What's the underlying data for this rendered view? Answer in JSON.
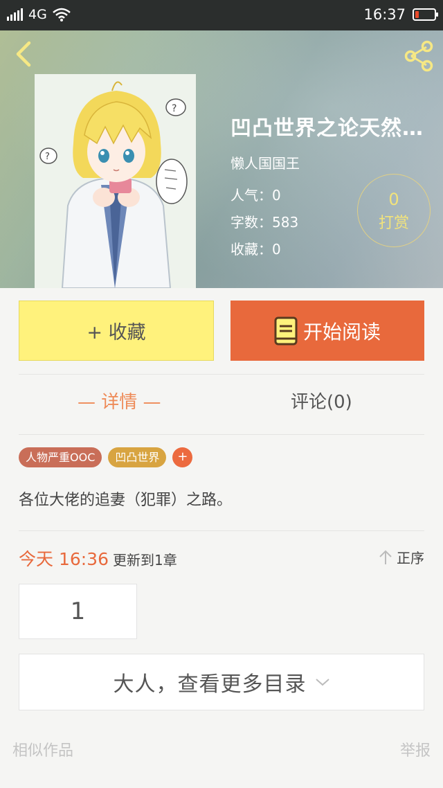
{
  "status_bar": {
    "network": "4G",
    "time": "16:37"
  },
  "book": {
    "title": "凹凸世界之论天然…",
    "author": "懒人国国王",
    "popularity": "人气：0",
    "word_count": "字数：583",
    "favorites": "收藏：0",
    "reward_count": "0",
    "reward_label": "打赏"
  },
  "actions": {
    "collect_label": "+ 收藏",
    "read_label": "开始阅读"
  },
  "tabs": {
    "detail": "— 详情 —",
    "comment": "评论(0)"
  },
  "tags": [
    "人物严重OOC",
    "凹凸世界",
    "+"
  ],
  "description": "各位大佬的追妻（犯罪）之路。",
  "update": {
    "time": "今天 16:36",
    "text": "更新到1章",
    "sort_label": "正序"
  },
  "chapters": [
    "1"
  ],
  "more_catalog": "大人，查看更多目录",
  "footer": {
    "similar": "相似作品",
    "report": "举报"
  },
  "colors": {
    "accent": "#e8693c",
    "collect": "#fff27c",
    "reward": "#f2e37b"
  },
  "icons": [
    "back-arrow-icon",
    "share-icon",
    "book-icon",
    "arrow-up-icon",
    "chevron-down-icon"
  ]
}
